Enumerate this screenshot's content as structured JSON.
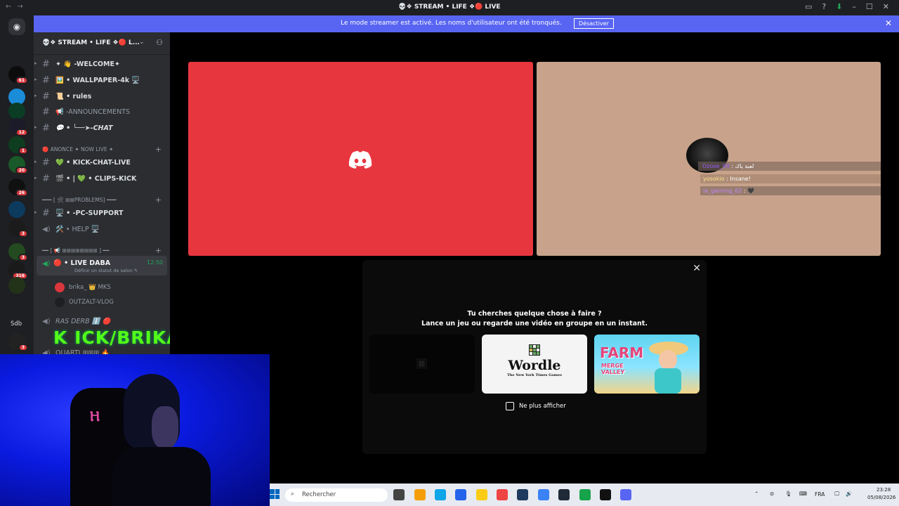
{
  "titlebar": {
    "title": "💀❖ STREAM • LIFE ❖🔴 LIVE"
  },
  "banner": {
    "text": "Le mode streamer est activé. Les noms d'utilisateur ont été tronqués.",
    "button": "Désactiver"
  },
  "guilds": [
    {
      "badge": ""
    },
    {
      "badge": "61"
    },
    {
      "badge": ""
    },
    {
      "badge": ""
    },
    {
      "badge": "12"
    },
    {
      "badge": "1"
    },
    {
      "badge": "20"
    },
    {
      "badge": "26"
    },
    {
      "badge": ""
    },
    {
      "badge": "3"
    },
    {
      "badge": "3"
    },
    {
      "badge": "316"
    },
    {
      "badge": ""
    },
    {
      "badge": "Sdb"
    },
    {
      "badge": "3"
    }
  ],
  "server": {
    "name": "💀❖ STREAM • LIFE ❖🔴 L..."
  },
  "channels": [
    {
      "label": "✦ 👋 -WELCOME✦",
      "dim": false
    },
    {
      "label": "🖼️ • WALLPAPER-4k 🖥️",
      "dim": false
    },
    {
      "label": "📜 • rules",
      "dim": false
    },
    {
      "label": "📢 -ANNOUNCEMENTS",
      "dim": true
    },
    {
      "label": "💬 • ╰──➤-CHAT",
      "dim": false
    }
  ],
  "category1": "🔴 ANONCE ✦ NOW LIVE ✦",
  "channels2": [
    {
      "label": "💚 • KICK-CHAT-LIVE"
    },
    {
      "label": "🎬 • | 💚 • CLIPS-KICK"
    }
  ],
  "category2": "━━━ [ 🛠 ⊞⊞PROBLEMS] ━━━",
  "channels3": [
    {
      "label": "🖥️ • -PC-SUPPORT",
      "dim": false
    },
    {
      "label": "🛠️ • HELP 🖥️",
      "dim": true
    }
  ],
  "category3": "━━ [ 📢 ⊞⊞⊞⊞⊞⊞⊞⊞ ] ━━",
  "voice": {
    "label": "🔴 • LIVE DABA",
    "sub": "Définir un statut de salon ✎",
    "time": "12:50"
  },
  "users": [
    {
      "name": "brika_  👑 MKS"
    },
    {
      "name": "OUTZALT-VLOG"
    }
  ],
  "more_channels": [
    {
      "label": "RAS DERB ℹ️ 🔴"
    },
    {
      "label": "QUARTI ⊞⊞⊞ 🔥"
    }
  ],
  "kick_overlay": "K ICK/BRIKAO",
  "stream_chat": [
    {
      "user": "Ozoxe_99",
      "msg": ": لعبة ياك"
    },
    {
      "user": "yosokio",
      "msg": ": Insane!"
    },
    {
      "user": "la_gaming_62",
      "msg": ": 🖤"
    }
  ],
  "activity": {
    "line1": "Tu cherches quelque chose à faire ?",
    "line2": "Lance un jeu ou regarde une vidéo en groupe en un instant.",
    "wordle_title": "Wordle",
    "wordle_sub": "The New York Times Games",
    "farm_title": "FARM",
    "farm_sub": "MERGE VALLEY",
    "checkbox": "Ne plus afficher"
  },
  "taskbar": {
    "search": "Rechercher",
    "lang": "FRA",
    "time": "23:28",
    "date": "05/08/2026"
  }
}
